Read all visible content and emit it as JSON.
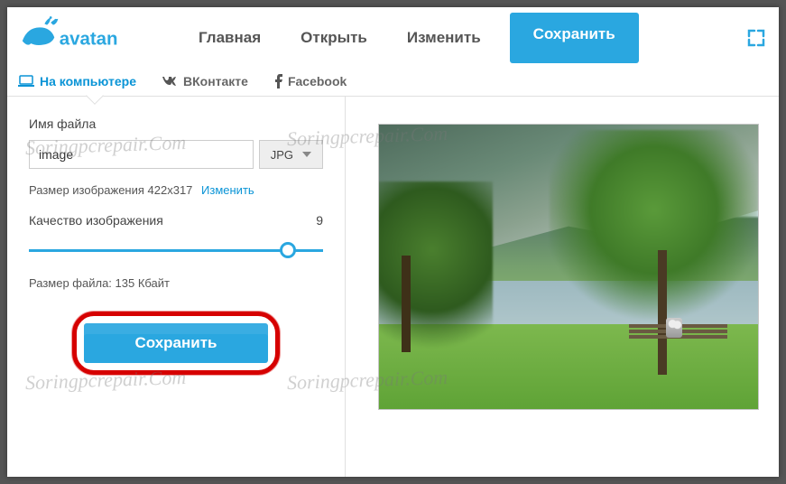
{
  "brand": "avatan",
  "nav": {
    "home": "Главная",
    "open": "Открыть",
    "edit": "Изменить",
    "save": "Сохранить"
  },
  "subnav": {
    "computer": "На компьютере",
    "vk": "ВКонтакте",
    "facebook": "Facebook"
  },
  "panel": {
    "filename_label": "Имя файла",
    "filename_value": "image",
    "format": "JPG",
    "dimensions_label": "Размер изображения 422x317",
    "change_link": "Изменить",
    "quality_label": "Качество изображения",
    "quality_value": "9",
    "filesize_label": "Размер файла: 135 Кбайт",
    "save_button": "Сохранить"
  },
  "watermark_text": "Soringpcrepair.Com",
  "colors": {
    "accent": "#2aa7e0",
    "highlight": "#d60000"
  }
}
